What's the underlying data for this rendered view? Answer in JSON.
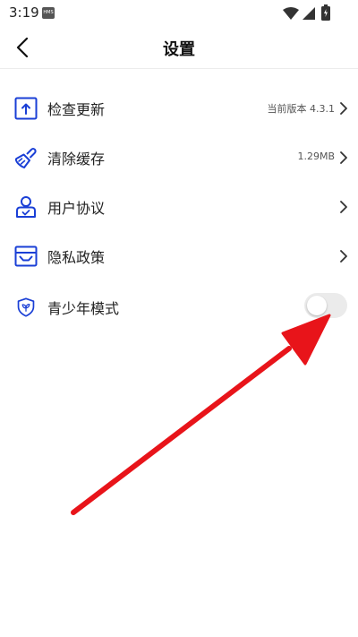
{
  "status_bar": {
    "time": "3:19",
    "hms_badge": "HMS",
    "icons": [
      "wifi-icon",
      "signal-icon",
      "battery-icon"
    ]
  },
  "header": {
    "title": "设置",
    "back_icon": "chevron-left-icon"
  },
  "settings": {
    "check_update": {
      "label": "检查更新",
      "value": "当前版本 4.3.1",
      "icon": "upload-icon"
    },
    "clear_cache": {
      "label": "清除缓存",
      "value": "1.29MB",
      "icon": "broom-icon"
    },
    "user_agreement": {
      "label": "用户协议",
      "icon": "user-shield-icon"
    },
    "privacy_policy": {
      "label": "隐私政策",
      "icon": "inbox-icon"
    },
    "teen_mode": {
      "label": "青少年模式",
      "icon": "shield-leaf-icon",
      "enabled": false
    }
  },
  "colors": {
    "accent": "#1a3fd6",
    "annotation": "#e8141a",
    "toggle_off": "#ebebeb"
  }
}
